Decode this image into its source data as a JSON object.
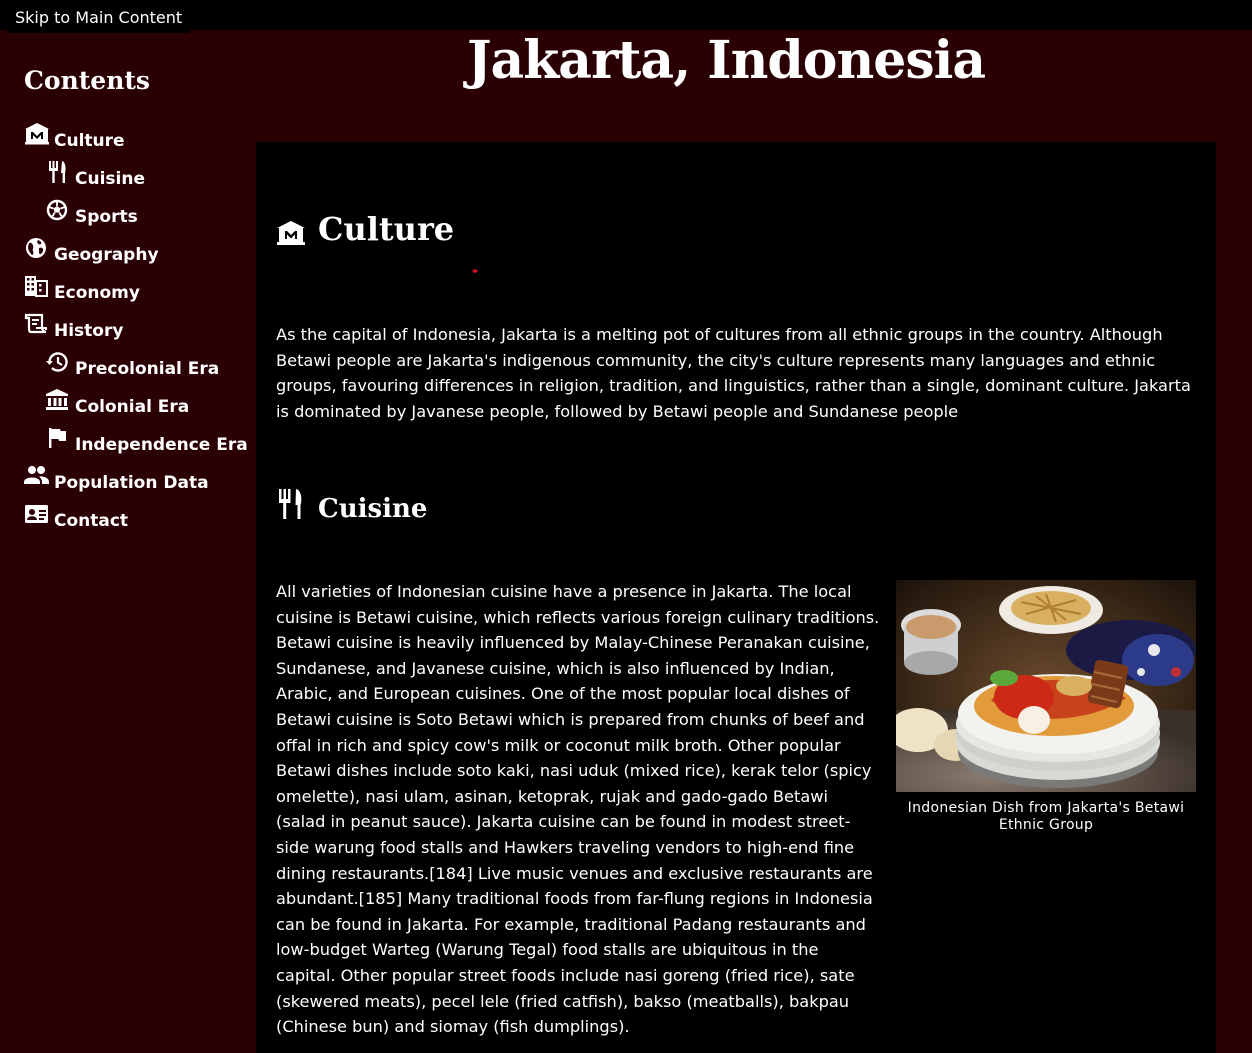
{
  "skip_link": "Skip to Main Content",
  "page_title": "Jakarta, Indonesia",
  "sidebar": {
    "title": "Contents",
    "items": [
      {
        "label": "Culture",
        "icon": "museum-icon",
        "level": 1
      },
      {
        "label": "Cuisine",
        "icon": "utensils-icon",
        "level": 2
      },
      {
        "label": "Sports",
        "icon": "soccer-ball-icon",
        "level": 2
      },
      {
        "label": "Geography",
        "icon": "globe-icon",
        "level": 1
      },
      {
        "label": "Economy",
        "icon": "buildings-icon",
        "level": 1
      },
      {
        "label": "History",
        "icon": "scroll-icon",
        "level": 1
      },
      {
        "label": "Precolonial Era",
        "icon": "history-clock-icon",
        "level": 2
      },
      {
        "label": "Colonial Era",
        "icon": "bank-icon",
        "level": 2
      },
      {
        "label": "Independence Era",
        "icon": "flag-icon",
        "level": 2
      },
      {
        "label": "Population Data",
        "icon": "people-icon",
        "level": 1
      },
      {
        "label": "Contact",
        "icon": "contact-card-icon",
        "level": 1
      }
    ]
  },
  "sections": {
    "culture": {
      "heading": "Culture",
      "icon": "museum-icon",
      "text": "As the capital of Indonesia, Jakarta is a melting pot of cultures from all ethnic groups in the country. Although Betawi people are Jakarta's indigenous community, the city's culture represents many languages and ethnic groups, favouring differences in religion, tradition, and linguistics, rather than a single, dominant culture. Jakarta is dominated by Javanese people, followed by Betawi people and Sundanese people"
    },
    "cuisine": {
      "heading": "Cuisine",
      "icon": "utensils-icon",
      "text": "All varieties of Indonesian cuisine have a presence in Jakarta. The local cuisine is Betawi cuisine, which reflects various foreign culinary traditions. Betawi cuisine is heavily influenced by Malay-Chinese Peranakan cuisine, Sundanese, and Javanese cuisine, which is also influenced by Indian, Arabic, and European cuisines. One of the most popular local dishes of Betawi cuisine is Soto Betawi which is prepared from chunks of beef and offal in rich and spicy cow's milk or coconut milk broth. Other popular Betawi dishes include soto kaki, nasi uduk (mixed rice), kerak telor (spicy omelette), nasi ulam, asinan, ketoprak, rujak and gado-gado Betawi (salad in peanut sauce). Jakarta cuisine can be found in modest street-side warung food stalls and Hawkers traveling vendors to high-end fine dining restaurants.[184] Live music venues and exclusive restaurants are abundant.[185] Many traditional foods from far-flung regions in Indonesia can be found in Jakarta. For example, traditional Padang restaurants and low-budget Warteg (Warung Tegal) food stalls are ubiquitous in the capital. Other popular street foods include nasi goreng (fried rice), sate (skewered meats), pecel lele (fried catfish), bakso (meatballs), bakpau (Chinese bun) and siomay (fish dumplings).",
      "image_caption": "Indonesian Dish from Jakarta's Betawi Ethnic Group"
    }
  },
  "colors": {
    "page_background": "#2a0004",
    "content_background": "#000000",
    "text": "#ffffff"
  }
}
